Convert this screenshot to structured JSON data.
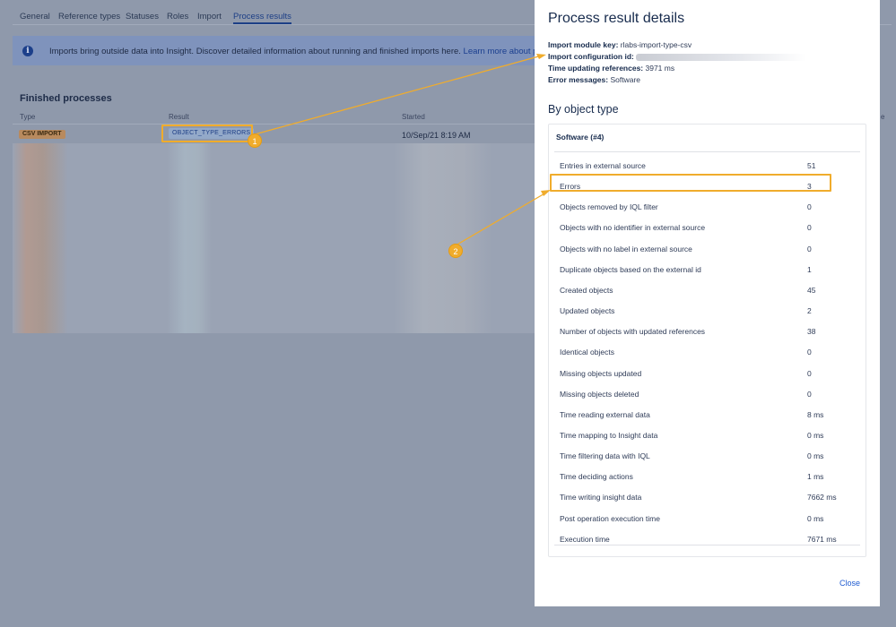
{
  "tabs": [
    {
      "label": "General"
    },
    {
      "label": "Reference types"
    },
    {
      "label": "Statuses"
    },
    {
      "label": "Roles"
    },
    {
      "label": "Import"
    },
    {
      "label": "Process results"
    }
  ],
  "banner": {
    "icon": "info-icon",
    "text": "Imports bring outside data into Insight. Discover detailed information about running and finished imports here. ",
    "link": "Learn more about proce"
  },
  "finished": {
    "title": "Finished processes",
    "columns": [
      "Type",
      "Result",
      "Started"
    ],
    "row": {
      "type": "CSV IMPORT",
      "result": "OBJECT_TYPE_ERRORS",
      "started": "10/Sep/21 8:19 AM"
    },
    "right_col_fragment": "e"
  },
  "annotations": {
    "marker1": "1",
    "marker2": "2",
    "color": "#f0ac2c"
  },
  "modal": {
    "title": "Process result details",
    "meta": [
      {
        "key": "Import module key:",
        "value": "rlabs-import-type-csv"
      },
      {
        "key": "Import configuration id:",
        "value": ""
      },
      {
        "key": "Time updating references:",
        "value": "3971 ms"
      },
      {
        "key": "Error messages:",
        "value": "Software"
      }
    ],
    "section_title": "By object type",
    "card_title": "Software (#4)",
    "stats": [
      {
        "label": "Entries in external source",
        "value": "51"
      },
      {
        "label": "Errors",
        "value": "3"
      },
      {
        "label": "Objects removed by IQL filter",
        "value": "0"
      },
      {
        "label": "Objects with no identifier in external source",
        "value": "0"
      },
      {
        "label": "Objects with no label in external source",
        "value": "0"
      },
      {
        "label": "Duplicate objects based on the external id",
        "value": "1"
      },
      {
        "label": "Created objects",
        "value": "45"
      },
      {
        "label": "Updated objects",
        "value": "2"
      },
      {
        "label": "Number of objects with updated references",
        "value": "38"
      },
      {
        "label": "Identical objects",
        "value": "0"
      },
      {
        "label": "Missing objects updated",
        "value": "0"
      },
      {
        "label": "Missing objects deleted",
        "value": "0"
      },
      {
        "label": "Time reading external data",
        "value": "8 ms"
      },
      {
        "label": "Time mapping to Insight data",
        "value": "0 ms"
      },
      {
        "label": "Time filtering data with IQL",
        "value": "0 ms"
      },
      {
        "label": "Time deciding actions",
        "value": "1 ms"
      },
      {
        "label": "Time writing insight data",
        "value": "7662 ms"
      },
      {
        "label": "Post operation execution time",
        "value": "0 ms"
      },
      {
        "label": "Execution time",
        "value": "7671 ms"
      }
    ],
    "close_label": "Close"
  }
}
